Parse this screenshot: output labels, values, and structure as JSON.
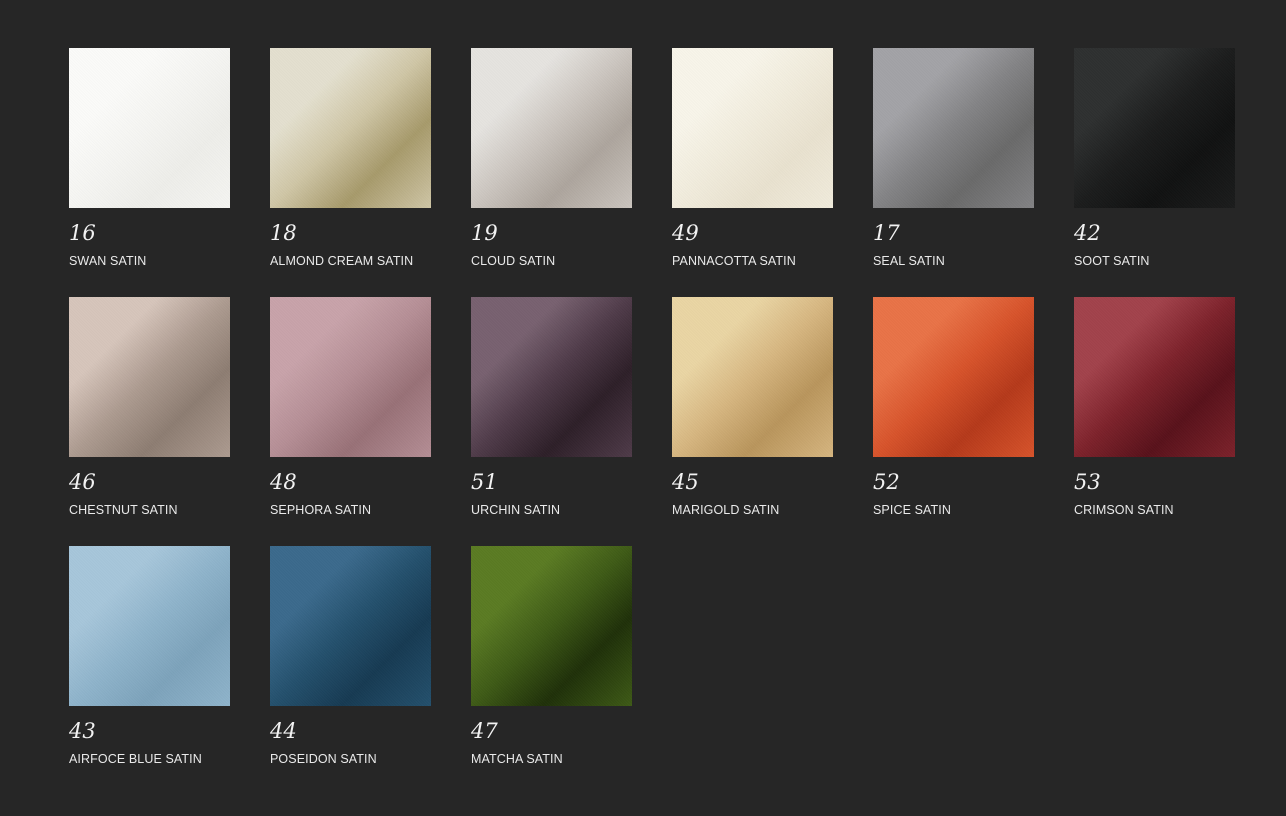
{
  "swatches": [
    {
      "number": "16",
      "name": "SWAN SATIN",
      "colors": {
        "light": "#fbfbf9",
        "mid": "#f5f5f2",
        "dark": "#eeeeea"
      }
    },
    {
      "number": "18",
      "name": "ALMOND CREAM SATIN",
      "colors": {
        "light": "#e4e0cf",
        "mid": "#cfc6a6",
        "dark": "#a79a6b"
      }
    },
    {
      "number": "19",
      "name": "CLOUD SATIN",
      "colors": {
        "light": "#e6e4e0",
        "mid": "#cbc5bf",
        "dark": "#ada59d"
      }
    },
    {
      "number": "49",
      "name": "PANNACOTTA SATIN",
      "colors": {
        "light": "#f8f5ea",
        "mid": "#f1ecdc",
        "dark": "#e9e2cf"
      }
    },
    {
      "number": "17",
      "name": "SEAL SATIN",
      "colors": {
        "light": "#a3a3a7",
        "mid": "#838385",
        "dark": "#6a6a6a"
      }
    },
    {
      "number": "42",
      "name": "SOOT SATIN",
      "colors": {
        "light": "#2e3030",
        "mid": "#1b1c1c",
        "dark": "#101111"
      }
    },
    {
      "number": "46",
      "name": "CHESTNUT SATIN",
      "colors": {
        "light": "#d6c5bb",
        "mid": "#ad9b90",
        "dark": "#8d7d72"
      }
    },
    {
      "number": "48",
      "name": "SEPHORA SATIN",
      "colors": {
        "light": "#c8a3aa",
        "mid": "#b58e95",
        "dark": "#987177"
      }
    },
    {
      "number": "51",
      "name": "URCHIN SATIN",
      "colors": {
        "light": "#786170",
        "mid": "#4f3b49",
        "dark": "#2d1f28"
      }
    },
    {
      "number": "45",
      "name": "MARIGOLD SATIN",
      "colors": {
        "light": "#ead5a4",
        "mid": "#d6b680",
        "dark": "#b9955c"
      }
    },
    {
      "number": "52",
      "name": "SPICE SATIN",
      "colors": {
        "light": "#e97347",
        "mid": "#d7532b",
        "dark": "#b5391a"
      }
    },
    {
      "number": "53",
      "name": "CRIMSON SATIN",
      "colors": {
        "light": "#a2424b",
        "mid": "#7d222b",
        "dark": "#58111a"
      }
    },
    {
      "number": "43",
      "name": "AIRFOCE BLUE SATIN",
      "colors": {
        "light": "#a7c6da",
        "mid": "#8fb4cb",
        "dark": "#7da3bb"
      }
    },
    {
      "number": "44",
      "name": "POSEIDON SATIN",
      "colors": {
        "light": "#3b6a8c",
        "mid": "#24506d",
        "dark": "#163a52"
      }
    },
    {
      "number": "47",
      "name": "MATCHA SATIN",
      "colors": {
        "light": "#5a7b23",
        "mid": "#3e5a16",
        "dark": "#1f3009"
      }
    }
  ]
}
